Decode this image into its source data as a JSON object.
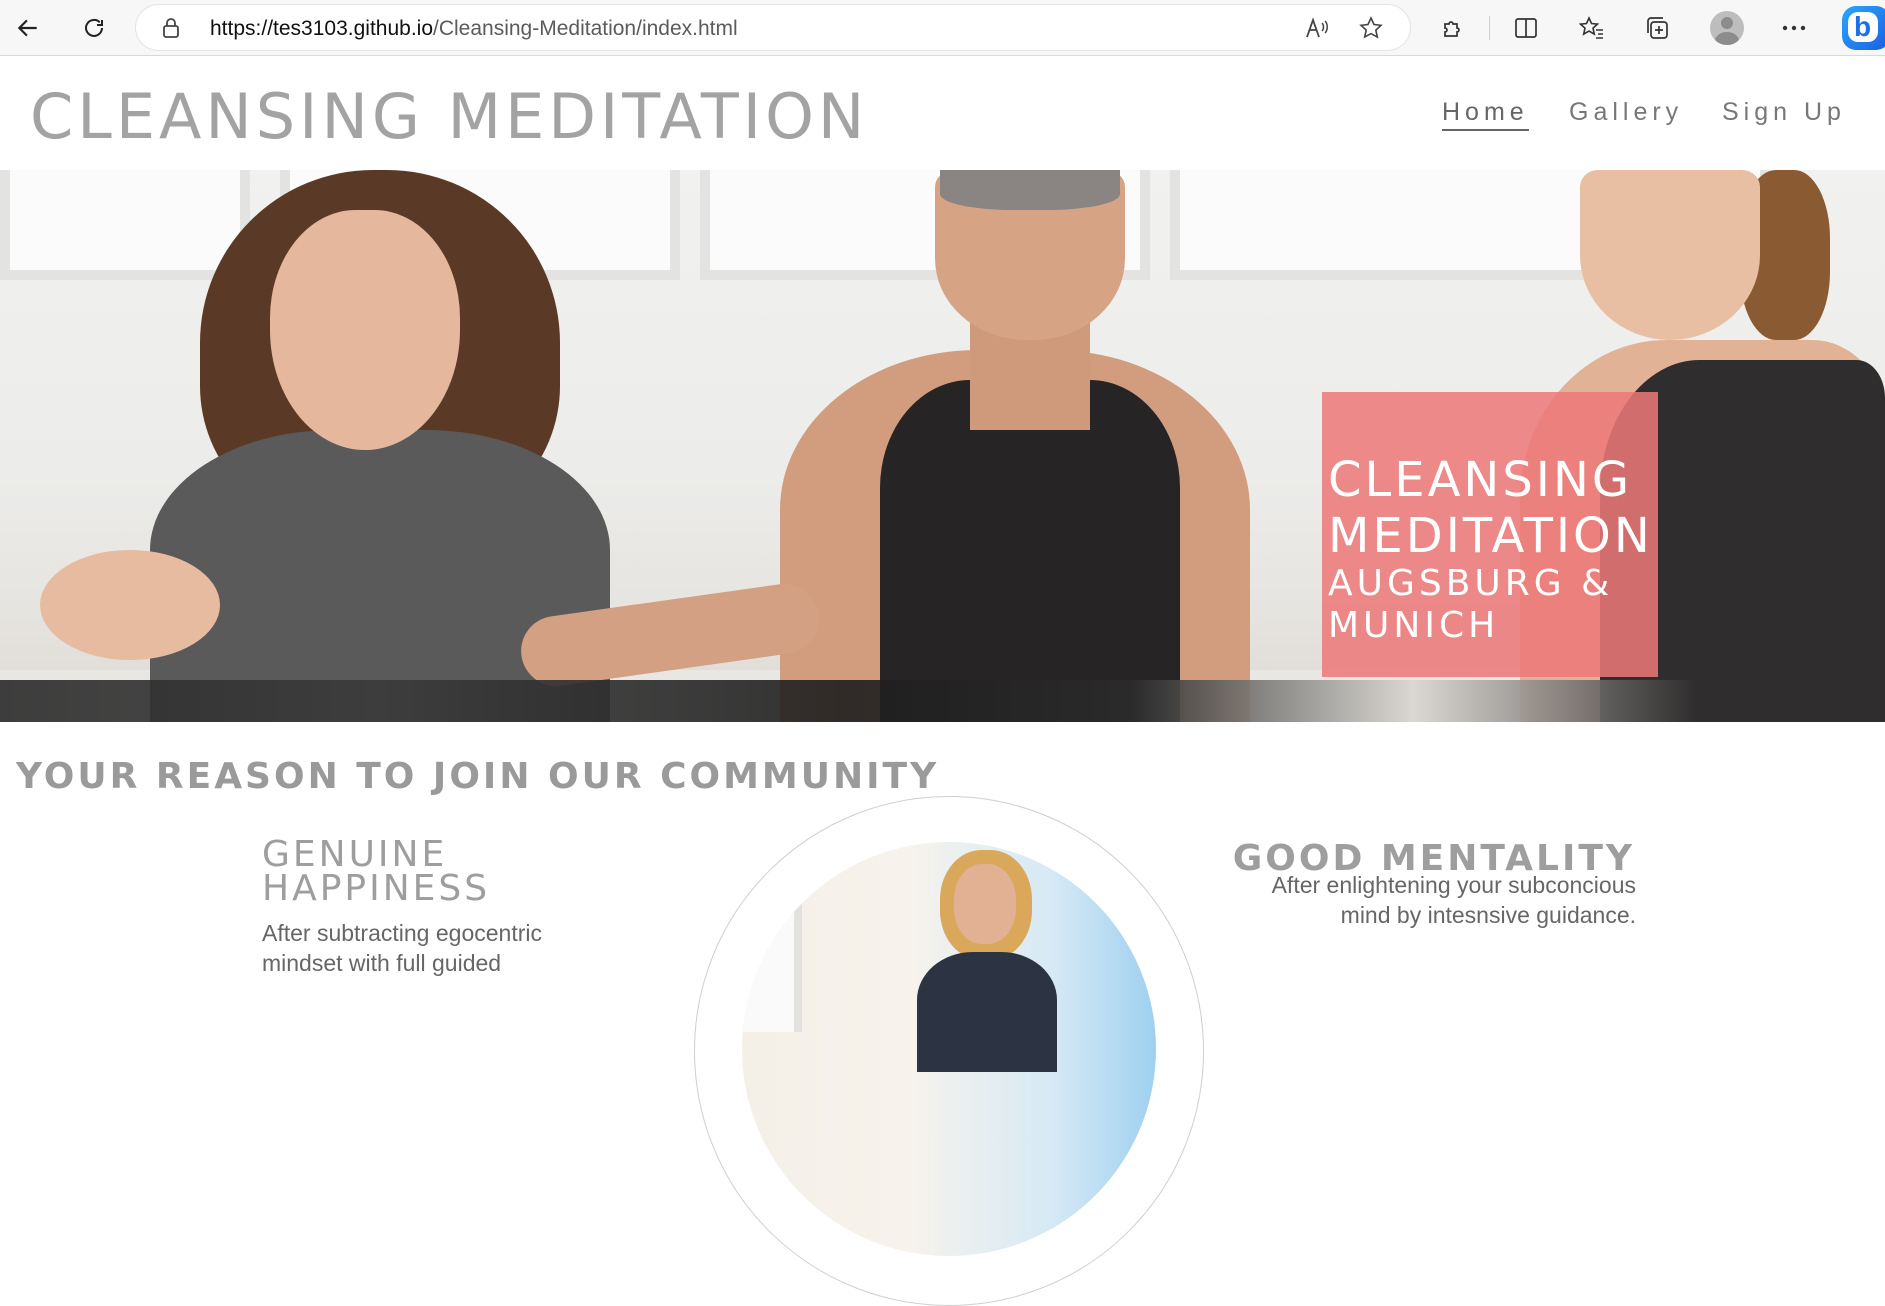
{
  "browser": {
    "url_host": "https://tes3103.github.io",
    "url_path": "/Cleansing-Meditation/index.html",
    "bing_label": "b"
  },
  "site": {
    "title": "CLEANSING MEDITATION",
    "nav": [
      {
        "label": "Home",
        "active": true
      },
      {
        "label": "Gallery",
        "active": false
      },
      {
        "label": "Sign Up",
        "active": false
      }
    ]
  },
  "hero": {
    "line1": "CLEANSING",
    "line2": "MEDITATION",
    "line3": "AUGSBURG &",
    "line4": "MUNICH",
    "box_color": "#ec7878"
  },
  "content": {
    "section_title": "YOUR REASON TO JOIN OUR COMMUNITY",
    "left_feature": {
      "title_line1": "GENUINE",
      "title_line2": "HAPPINESS",
      "text": "After subtracting egocentric mindset with full guided"
    },
    "right_feature": {
      "title": "GOOD MENTALITY",
      "text": "After enlightening your subconcious mind by intesnsive guidance."
    }
  }
}
